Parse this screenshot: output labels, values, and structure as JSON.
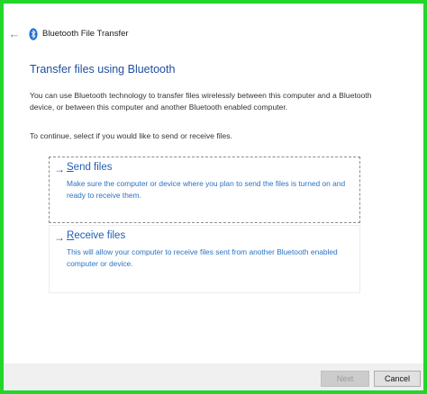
{
  "window": {
    "title": "Bluetooth File Transfer",
    "back_glyph": "←",
    "back_icon": "back-arrow-icon",
    "app_icon": "bluetooth-icon"
  },
  "content": {
    "heading": "Transfer files using Bluetooth",
    "description": "You can use Bluetooth technology to transfer files wirelessly between this computer and a Bluetooth device, or between this computer and another Bluetooth enabled computer.",
    "instruction": "To continue, select if you would like to send or receive files."
  },
  "options": {
    "send": {
      "arrow": "→",
      "underlined_letter": "S",
      "title_rest": "end files",
      "description": "Make sure the computer or device where you plan to send the files is turned on and ready to receive them."
    },
    "receive": {
      "arrow": "→",
      "underlined_letter": "R",
      "title_rest": "eceive files",
      "description": "This will allow your computer to receive files sent from another Bluetooth enabled computer or device."
    }
  },
  "footer": {
    "next_label": "Next",
    "next_enabled": false,
    "cancel_label": "Cancel"
  },
  "colors": {
    "frame": "#22d62a",
    "accent": "#1f5fb5",
    "heading": "#1f4e9e"
  }
}
